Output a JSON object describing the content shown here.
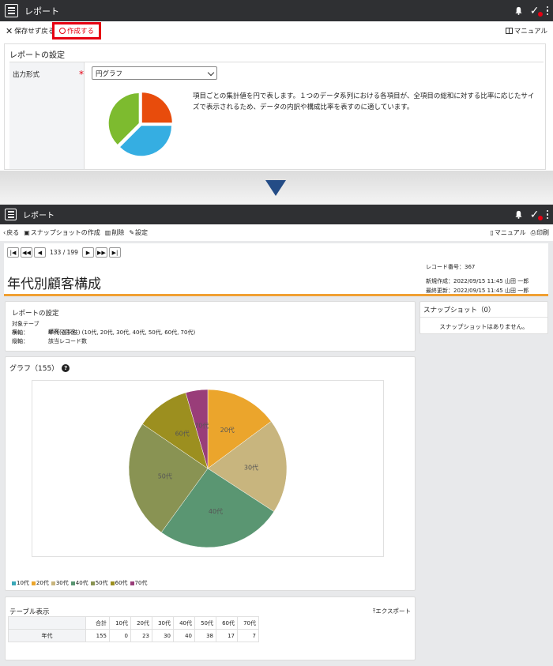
{
  "app": {
    "title": "レポート"
  },
  "before": {
    "toolbar": {
      "cancel_label": "保存せず戻る",
      "create_label": "作成する",
      "manual_label": "マニュアル"
    },
    "settings": {
      "title": "レポートの設定",
      "output_label": "出力形式",
      "required_mark": "*",
      "output_value": "円グラフ",
      "description": "項目ごとの集計値を円で表します。１つのデータ系列における各項目が、全項目の総和に対する比率に応じたサイズで表示されるため、データの内訳や構成比率を表すのに適しています。"
    },
    "sample_pie": {
      "colors": [
        "#e84c0c",
        "#35aee2",
        "#7dbb2f"
      ],
      "shares": [
        0.25,
        0.375,
        0.375
      ]
    }
  },
  "after": {
    "toolbar": {
      "back_label": "戻る",
      "snapshot_label": "スナップショットの作成",
      "delete_label": "削除",
      "settings_label": "設定",
      "manual_label": "マニュアル",
      "print_label": "印刷"
    },
    "pager": {
      "text": "133 / 199"
    },
    "record": {
      "title": "年代別顧客構成",
      "record_no": "レコード番号：367",
      "created": "新規作成：2022/09/15 11:45 山田 一郎",
      "updated": "最終更新：2022/09/15 11:45 山田 一郎"
    },
    "report_settings": {
      "title": "レポートの設定",
      "rows": [
        {
          "key": "対象テーブル：",
          "value": "顧客マスタ"
        },
        {
          "key": "横軸：",
          "value": "年代(選択肢) (10代, 20代, 30代, 40代, 50代, 60代, 70代)"
        },
        {
          "key": "縦軸：",
          "value": "該当レコード数"
        }
      ]
    },
    "snapshot": {
      "title": "スナップショット（0）",
      "empty": "スナップショットはありません。"
    },
    "graph": {
      "title": "グラフ（155）",
      "help": "?"
    },
    "table": {
      "title": "テーブル表示",
      "export_label": "エクスポート",
      "headers": [
        "合計",
        "10代",
        "20代",
        "30代",
        "40代",
        "50代",
        "60代",
        "70代"
      ],
      "row_label": "年代",
      "values": [
        "155",
        "0",
        "23",
        "30",
        "40",
        "38",
        "17",
        "7"
      ]
    }
  },
  "chart_data": {
    "type": "pie",
    "title": "",
    "categories": [
      "10代",
      "20代",
      "30代",
      "40代",
      "50代",
      "60代",
      "70代"
    ],
    "values": [
      0,
      23,
      30,
      40,
      38,
      17,
      7
    ],
    "colors": [
      "#3aa8b8",
      "#eba52c",
      "#c8b57e",
      "#5a9672",
      "#899353",
      "#9c8f1f",
      "#993d79"
    ],
    "legend": "bottom-left"
  }
}
